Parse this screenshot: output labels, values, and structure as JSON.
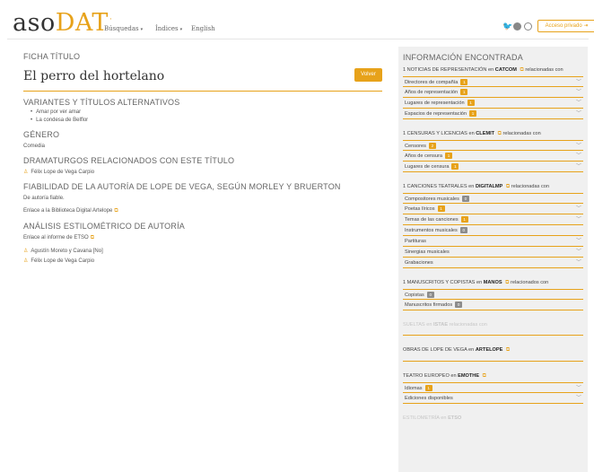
{
  "header": {
    "logo_a": "aso",
    "logo_b": "DAT",
    "nav": [
      {
        "label": "Búsquedas",
        "caret": "▾"
      },
      {
        "label": "Índices",
        "caret": "▾"
      },
      {
        "label": "English",
        "caret": ""
      }
    ],
    "social_icons": [
      "twitter-icon",
      "facebook-icon",
      "instagram-icon"
    ],
    "private_button": "Acceso privado ⇥"
  },
  "main": {
    "section_label": "FICHA TÍTULO",
    "title": "El perro del hortelano",
    "back_button": "Volver",
    "variants_heading": "VARIANTES Y TÍTULOS ALTERNATIVOS",
    "variants": [
      "Amar por ver amar",
      "La condesa de Belflor"
    ],
    "genre_heading": "GÉNERO",
    "genre": "Comedia",
    "playwrights_heading": "DRAMATURGOS RELACIONADOS CON ESTE TÍTULO",
    "playwrights": [
      "Félix Lope de Vega Carpio"
    ],
    "reliability_heading": "FIABILIDAD DE LA AUTORÍA DE LOPE DE VEGA, SEGÚN MORLEY Y BRUERTON",
    "reliability_text": "De autoría fiable.",
    "reliability_link": "Enlace a la Biblioteca Digital Artelope",
    "stylometric_heading": "ANÁLISIS ESTILOMÉTRICO DE AUTORÍA",
    "stylometric_link": "Enlace al informe de ETSO",
    "stylometric_people": [
      "Agustín Moreto y Cavana  [No]",
      "Félix Lope de Vega Carpio"
    ]
  },
  "sidebar": {
    "heading": "INFORMACIÓN ENCONTRADA",
    "blocks": [
      {
        "prefix": "1 NOTICIAS DE REPRESENTACIÓN en ",
        "db": "CATCOM",
        "suffix": " relacionadas con",
        "items": [
          {
            "label": "Directores de compañía",
            "count": "1",
            "badge": "orange"
          },
          {
            "label": "Años de representación",
            "count": "1",
            "badge": "orange"
          },
          {
            "label": "Lugares de representación",
            "count": "1",
            "badge": "orange"
          },
          {
            "label": "Espacios de representación",
            "count": "1",
            "badge": "orange"
          }
        ]
      },
      {
        "prefix": "1 CENSURAS Y LICENCIAS en ",
        "db": "CLEMIT",
        "suffix": " relacionadas con",
        "items": [
          {
            "label": "Censores",
            "count": "2",
            "badge": "orange"
          },
          {
            "label": "Años de censura",
            "count": "1",
            "badge": "orange"
          },
          {
            "label": "Lugares de censura",
            "count": "1",
            "badge": "orange"
          }
        ]
      },
      {
        "prefix": "1 CANCIONES TEATRALES en ",
        "db": "DIGITALMP",
        "suffix": " relacionadas con",
        "items": [
          {
            "label": "Compositores musicales",
            "count": "0",
            "badge": "grey"
          },
          {
            "label": "Poetas líricos",
            "count": "1",
            "badge": "orange"
          },
          {
            "label": "Temas de las canciones",
            "count": "1",
            "badge": "orange"
          },
          {
            "label": "Instrumentos musicales",
            "count": "0",
            "badge": "grey"
          },
          {
            "label": "Partituras",
            "count": "",
            "badge": ""
          },
          {
            "label": "Sinergias musicales",
            "count": "",
            "badge": ""
          },
          {
            "label": "Grabaciones",
            "count": "",
            "badge": ""
          }
        ]
      },
      {
        "prefix": "1 MANUSCRITOS Y COPISTAS en ",
        "db": "MANOS",
        "suffix": " relacionados con",
        "items": [
          {
            "label": "Copistas",
            "count": "0",
            "badge": "grey"
          },
          {
            "label": "Manuscritos firmados",
            "count": "0",
            "badge": "grey"
          }
        ]
      }
    ],
    "sueltas": {
      "prefix": "SUELTAS en ",
      "db": "ISTAE",
      "suffix": " relacionadas con"
    },
    "artelope": {
      "prefix": "OBRAS DE LOPE DE VEGA en ",
      "db": "ARTELOPE"
    },
    "emothe": {
      "prefix": "TEATRO EUROPEO en ",
      "db": "EMOTHE",
      "items": [
        {
          "label": "Idiomas",
          "count": "1",
          "badge": "orange"
        },
        {
          "label": "Ediciones disponibles",
          "count": "",
          "badge": ""
        }
      ]
    },
    "estilometria": {
      "prefix": "ESTILOMETRÍA en ",
      "db": "ETSO"
    }
  },
  "colors": {
    "accent": "#e7a21a",
    "badge_grey": "#8c8c8c",
    "sidebar_bg": "#f0f0f0"
  }
}
